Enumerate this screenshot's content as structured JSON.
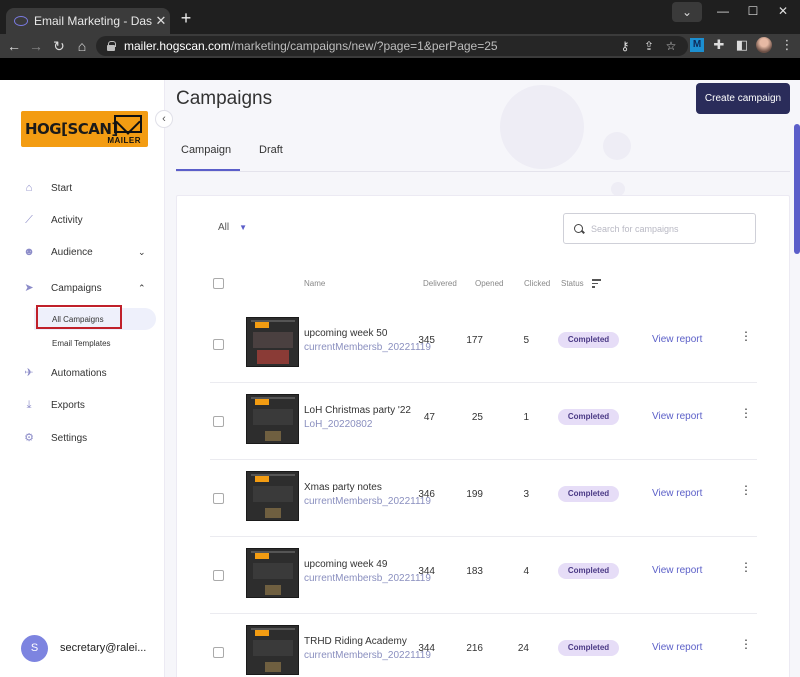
{
  "browser": {
    "tab_title": "Email Marketing - Dashboard",
    "tab_close": "✕",
    "new_tab": "+",
    "url_host": "mailer.hogscan.com",
    "url_path": "/marketing/campaigns/new/?page=1&perPage=25",
    "window_controls": {
      "dropdown": "⌄",
      "minimize": "—",
      "maximize": "☐",
      "close": "✕"
    },
    "extension_badge": "M"
  },
  "sidebar": {
    "logo_text": "HOG[SCAN]",
    "logo_sub": "MAILER",
    "collapse_glyph": "‹",
    "items": [
      {
        "label": "Start",
        "icon": "home-icon"
      },
      {
        "label": "Activity",
        "icon": "chart-line-icon"
      },
      {
        "label": "Audience",
        "icon": "users-icon",
        "chevron": "⌄"
      },
      {
        "label": "Campaigns",
        "icon": "paper-plane-icon",
        "chevron": "⌃"
      },
      {
        "label": "Automations",
        "icon": "rocket-icon"
      },
      {
        "label": "Exports",
        "icon": "download-icon"
      },
      {
        "label": "Settings",
        "icon": "gear-icon"
      }
    ],
    "subitems": [
      {
        "label": "All Campaigns",
        "active": true
      },
      {
        "label": "Email Templates",
        "active": false
      }
    ],
    "user": {
      "initial": "S",
      "email": "secretary@ralei..."
    }
  },
  "main": {
    "title": "Campaigns",
    "create_button": "Create campaign",
    "tabs": [
      {
        "label": "Campaign",
        "active": true
      },
      {
        "label": "Draft",
        "active": false
      }
    ],
    "filter": {
      "selected": "All",
      "caret": "▼"
    },
    "search": {
      "placeholder": "Search for campaigns",
      "value": ""
    },
    "columns": {
      "name": "Name",
      "delivered": "Delivered",
      "opened": "Opened",
      "clicked": "Clicked",
      "status": "Status"
    },
    "rows": [
      {
        "name": "upcoming week 50",
        "list": "currentMembersb_20221119",
        "delivered": "345",
        "opened": "177",
        "clicked": "5",
        "status": "Completed",
        "action": "View report",
        "thumb": "style1"
      },
      {
        "name": "LoH Christmas party '22",
        "list": "LoH_20220802",
        "delivered": "47",
        "opened": "25",
        "clicked": "1",
        "status": "Completed",
        "action": "View report",
        "thumb": "style2"
      },
      {
        "name": "Xmas party notes",
        "list": "currentMembersb_20221119",
        "delivered": "346",
        "opened": "199",
        "clicked": "3",
        "status": "Completed",
        "action": "View report",
        "thumb": "style2"
      },
      {
        "name": "upcoming week 49",
        "list": "currentMembersb_20221119",
        "delivered": "344",
        "opened": "183",
        "clicked": "4",
        "status": "Completed",
        "action": "View report",
        "thumb": "style2"
      },
      {
        "name": "TRHD Riding Academy",
        "list": "currentMembersb_20221119",
        "delivered": "344",
        "opened": "216",
        "clicked": "24",
        "status": "Completed",
        "action": "View report",
        "thumb": "style2"
      }
    ]
  },
  "colors": {
    "accent": "#5b5ec9",
    "primary_button": "#2a2c5a",
    "badge_bg": "#e6ddf7",
    "logo_orange": "#f39c12",
    "active_highlight": "#c0202a"
  }
}
